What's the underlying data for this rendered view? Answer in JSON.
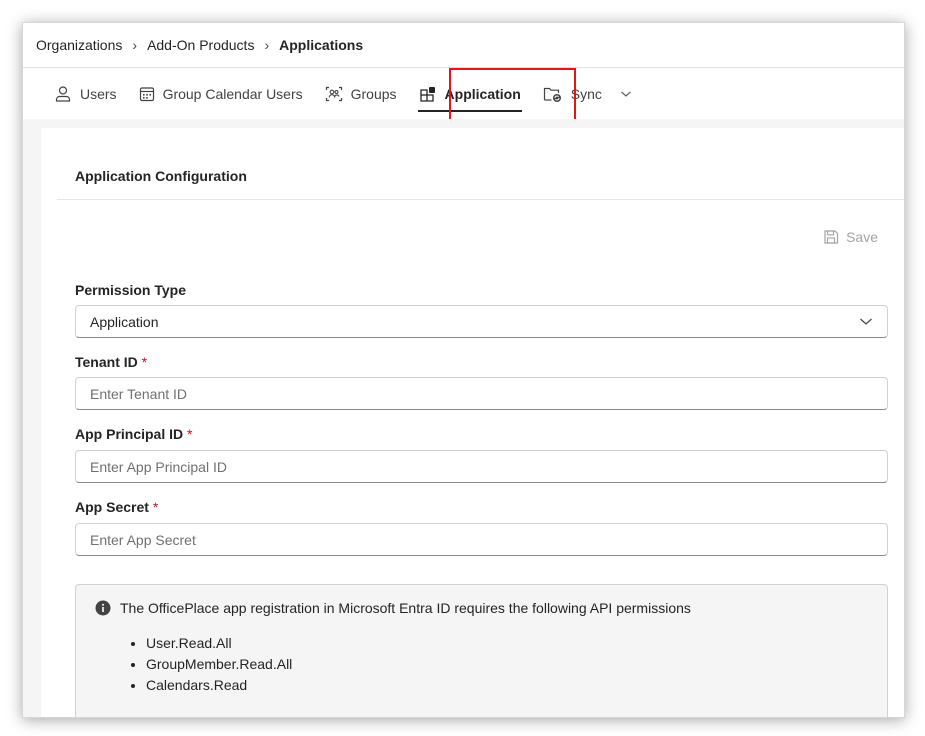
{
  "breadcrumb": {
    "items": [
      "Organizations",
      "Add-On Products"
    ],
    "current": "Applications"
  },
  "tabs": [
    {
      "label": "Users",
      "icon": "user-icon"
    },
    {
      "label": "Group Calendar Users",
      "icon": "calendar-icon"
    },
    {
      "label": "Groups",
      "icon": "groups-icon"
    },
    {
      "label": "Application",
      "icon": "app-add-icon",
      "active": true
    },
    {
      "label": "Sync",
      "icon": "sync-folder-icon",
      "has_dropdown": true
    }
  ],
  "section": {
    "title": "Application Configuration",
    "save_label": "Save"
  },
  "form": {
    "permission_type": {
      "label": "Permission Type",
      "value": "Application"
    },
    "tenant_id": {
      "label": "Tenant ID",
      "required": "*",
      "placeholder": "Enter Tenant ID"
    },
    "app_principal_id": {
      "label": "App Principal ID",
      "required": "*",
      "placeholder": "Enter App Principal ID"
    },
    "app_secret": {
      "label": "App Secret",
      "required": "*",
      "placeholder": "Enter App Secret"
    }
  },
  "info": {
    "message": "The OfficePlace app registration in Microsoft Entra ID requires the following API permissions",
    "permissions": [
      "User.Read.All",
      "GroupMember.Read.All",
      "Calendars.Read"
    ]
  },
  "colors": {
    "highlight_box": "#e3151a",
    "required_marker": "#c50f1f",
    "panel_background": "#f5f5f5"
  }
}
